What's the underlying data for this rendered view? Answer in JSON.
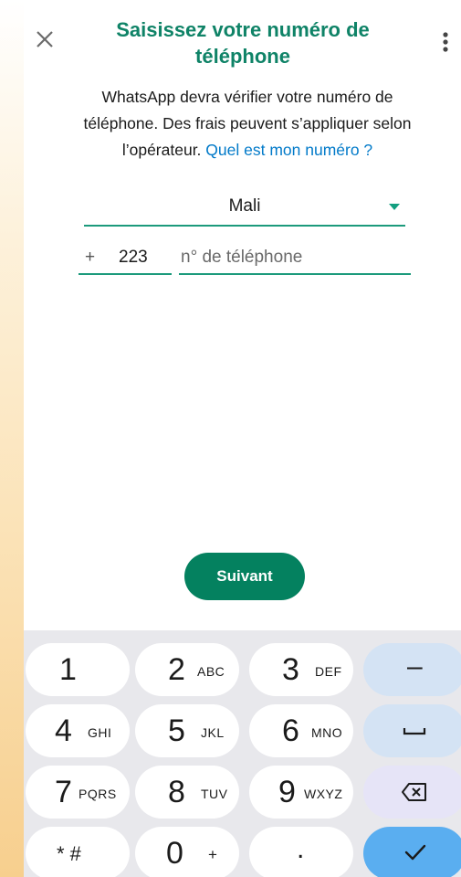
{
  "header": {
    "title_line1": "Saisissez votre numéro de",
    "title_line2": "téléphone",
    "close_icon": "close-icon",
    "more_icon": "more-vertical-icon"
  },
  "intro": {
    "line1": "WhatsApp devra vérifier votre numéro de",
    "line2": "téléphone. Des frais peuvent s’appliquer selon",
    "line3": "l’opérateur.",
    "link": "Quel est mon numéro ?"
  },
  "country": {
    "selected": "Mali",
    "icon": "dropdown-arrow-icon"
  },
  "phone": {
    "plus": "+",
    "country_code": "223",
    "placeholder": "n° de téléphone"
  },
  "next_button": "Suivant",
  "keypad": {
    "k1": {
      "digit": "1",
      "letters": ""
    },
    "k2": {
      "digit": "2",
      "letters": "ABC"
    },
    "k3": {
      "digit": "3",
      "letters": "DEF"
    },
    "k4": {
      "digit": "4",
      "letters": "GHI"
    },
    "k5": {
      "digit": "5",
      "letters": "JKL"
    },
    "k6": {
      "digit": "6",
      "letters": "MNO"
    },
    "k7": {
      "digit": "7",
      "letters": "PQRS"
    },
    "k8": {
      "digit": "8",
      "letters": "TUV"
    },
    "k9": {
      "digit": "9",
      "letters": "WXYZ"
    },
    "star_hash": "* #",
    "k0": {
      "digit": "0",
      "letters": "+"
    },
    "dot": ".",
    "minus": "–",
    "space_icon": "space-bar-icon",
    "backspace_icon": "backspace-icon",
    "done_icon": "checkmark-icon"
  },
  "colors": {
    "accent": "#0f8367",
    "link": "#027ac9",
    "button": "#04815f",
    "keypad_bg": "#e8e8ec"
  }
}
